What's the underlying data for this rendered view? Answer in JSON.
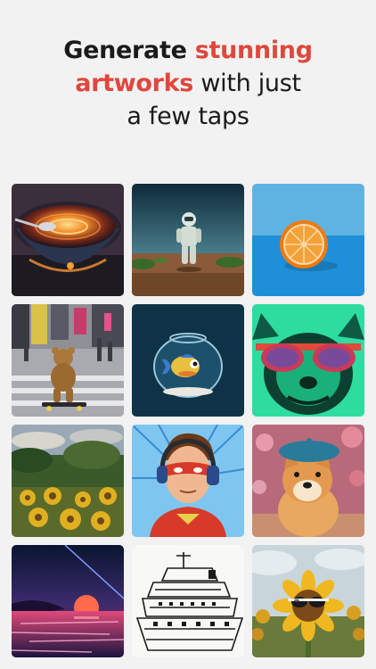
{
  "headline": {
    "line1_plain": "Generate ",
    "line1_accent": "stunning",
    "line2_accent": "artworks",
    "line2_plain": " with just",
    "line3": "a few taps"
  },
  "colors": {
    "accent": "#e0473c",
    "text": "#1a1a1a",
    "background": "#f2f2f2"
  },
  "gallery": [
    "galaxy-soup-bowl",
    "astronaut-in-desert",
    "orange-half-on-blue",
    "teddy-bear-skateboarding-city",
    "fish-in-bowl",
    "pop-art-bulldog-sunglasses",
    "sunflower-field-painting",
    "comic-superhero-headphones",
    "shiba-dog-beret",
    "synthwave-sunset-sea",
    "cruise-ship-sketch",
    "sunflower-with-sunglasses"
  ]
}
